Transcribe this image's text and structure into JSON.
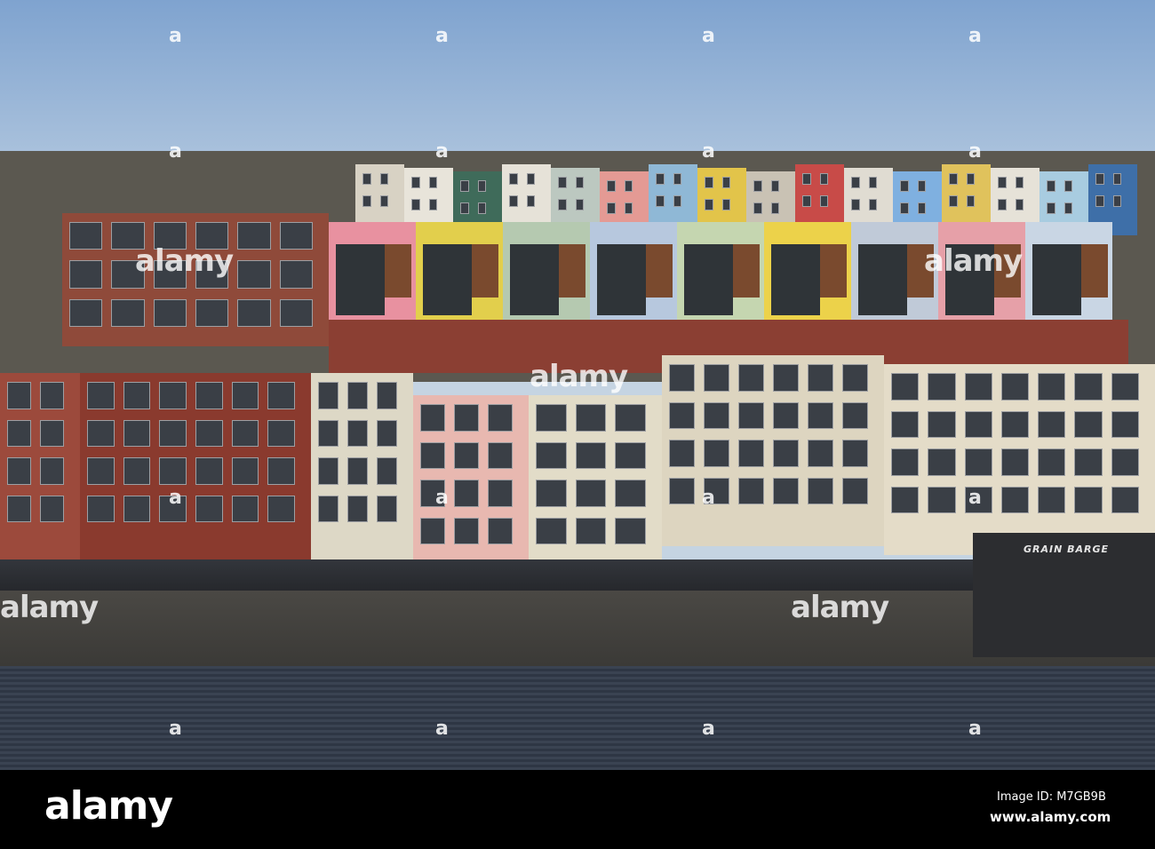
{
  "scene": {
    "top_row_colors": [
      "#d8d2c4",
      "#e8e4da",
      "#3f6b5a",
      "#e6e2d8",
      "#bcc8c0",
      "#e49a94",
      "#8fb8d6",
      "#e2c44a",
      "#c9c2b4",
      "#c84b48",
      "#e0dcd2",
      "#7fb0e0",
      "#e0c25c",
      "#e6e2d8",
      "#a8cce0",
      "#3e6fa8"
    ],
    "terrace_colors": [
      "#e891a0",
      "#e2cf4c",
      "#b5c9b0",
      "#b7c8de",
      "#c5d6b0",
      "#ecd24a",
      "#c0cad8",
      "#e6a0a8",
      "#c9d6e4"
    ],
    "waterfront_colors": [
      "#9c4a3c",
      "#8a3a2e",
      "#ddd8c6",
      "#e8b8b0",
      "#e2dcc8",
      "#ddd5c0",
      "#e4dcc8"
    ],
    "boat_sign": "GRAIN BARGE"
  },
  "watermark": {
    "text": "alamy",
    "letter": "a"
  },
  "footer": {
    "logo": "alamy",
    "image_id": "Image ID: M7GB9B",
    "site": "www.alamy.com"
  }
}
